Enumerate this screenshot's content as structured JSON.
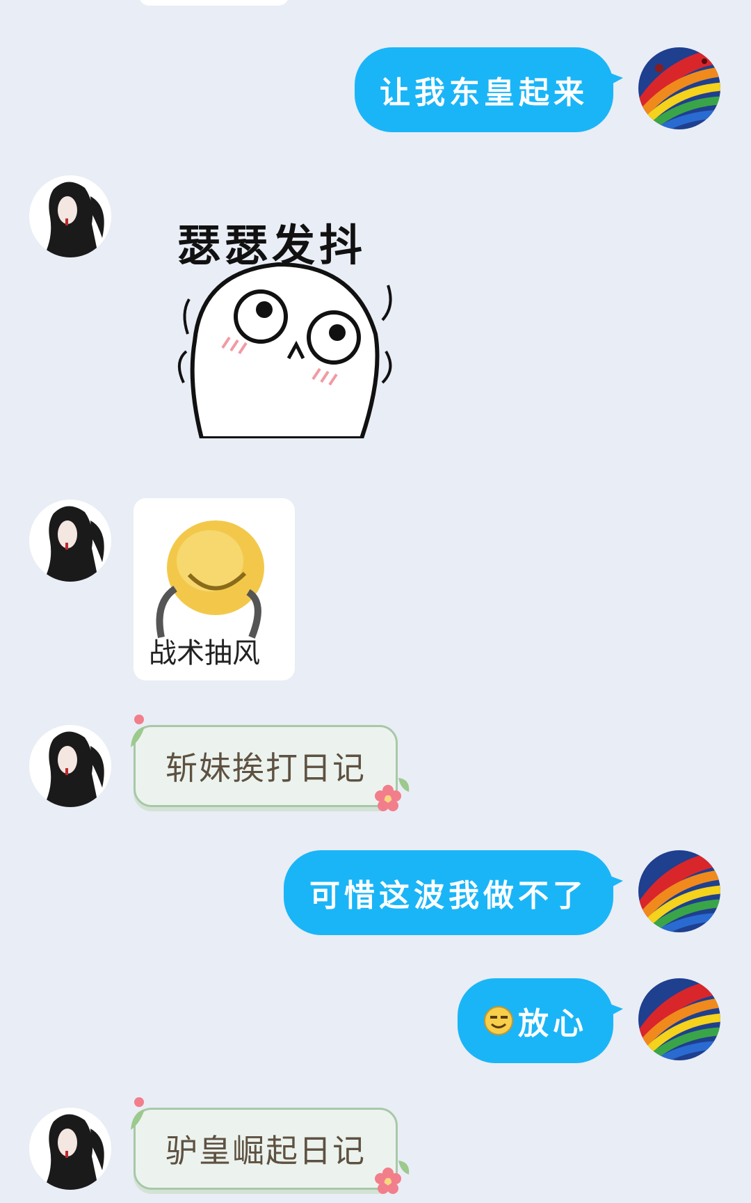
{
  "messages": {
    "m1": {
      "sender": "self",
      "text": "让我东皇起来"
    },
    "m2": {
      "sender": "other",
      "type": "sticker",
      "text": "瑟瑟发抖"
    },
    "m3": {
      "sender": "other",
      "type": "sticker",
      "text": "战术抽风"
    },
    "m4": {
      "sender": "other",
      "text": "斩妹挨打日记"
    },
    "m5": {
      "sender": "self",
      "text": "可惜这波我做不了"
    },
    "m6": {
      "sender": "self",
      "text": "放心",
      "emoji": "grinning-emoji-icon"
    },
    "m7": {
      "sender": "other",
      "text": "驴皇崛起日记"
    }
  },
  "colors": {
    "background": "#e9edf5",
    "self_bubble": "#1ab5f7",
    "other_bubble": "#ecf3ee",
    "other_bubble_border": "#a7c8a8",
    "other_text": "#5e5141"
  },
  "icons": {
    "self_avatar": "rainbow-avatar-icon",
    "other_avatar": "anime-character-avatar-icon"
  }
}
